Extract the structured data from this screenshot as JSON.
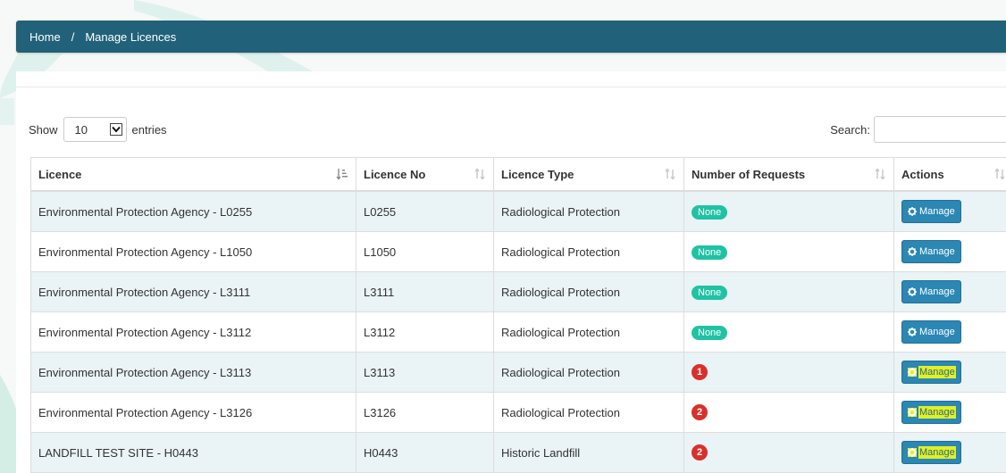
{
  "breadcrumb": {
    "home": "Home",
    "separator": "/",
    "current": "Manage Licences"
  },
  "length_control": {
    "prefix": "Show",
    "value": "10",
    "suffix": "entries"
  },
  "search": {
    "label": "Search:",
    "value": ""
  },
  "table": {
    "columns": [
      "Licence",
      "Licence No",
      "Licence Type",
      "Number of Requests",
      "Actions"
    ],
    "rows": [
      {
        "licence": "Environmental Protection Agency - L0255",
        "licence_no": "L0255",
        "licence_type": "Radiological Protection",
        "requests": "None",
        "action": "Manage",
        "highlight": false
      },
      {
        "licence": "Environmental Protection Agency - L1050",
        "licence_no": "L1050",
        "licence_type": "Radiological Protection",
        "requests": "None",
        "action": "Manage",
        "highlight": false
      },
      {
        "licence": "Environmental Protection Agency - L3111",
        "licence_no": "L3111",
        "licence_type": "Radiological Protection",
        "requests": "None",
        "action": "Manage",
        "highlight": false
      },
      {
        "licence": "Environmental Protection Agency - L3112",
        "licence_no": "L3112",
        "licence_type": "Radiological Protection",
        "requests": "None",
        "action": "Manage",
        "highlight": false
      },
      {
        "licence": "Environmental Protection Agency - L3113",
        "licence_no": "L3113",
        "licence_type": "Radiological Protection",
        "requests": "1",
        "action": "Manage",
        "highlight": true
      },
      {
        "licence": "Environmental Protection Agency - L3126",
        "licence_no": "L3126",
        "licence_type": "Radiological Protection",
        "requests": "2",
        "action": "Manage",
        "highlight": true
      },
      {
        "licence": "LANDFILL TEST SITE - H0443",
        "licence_no": "H0443",
        "licence_type": "Historic Landfill",
        "requests": "2",
        "action": "Manage",
        "highlight": true
      }
    ]
  },
  "colors": {
    "header_bar": "#21617a",
    "badge_none": "#1fc3a3",
    "badge_count": "#d9302c",
    "manage_button": "#2b87b4",
    "highlight": "#e1f024",
    "row_stripe": "#eaf3f5"
  },
  "icons": {
    "sort_active": "sort-asc-icon",
    "sort_inactive": "sort-both-icon",
    "button": "gear-icon",
    "select": "chevron-down-icon"
  }
}
